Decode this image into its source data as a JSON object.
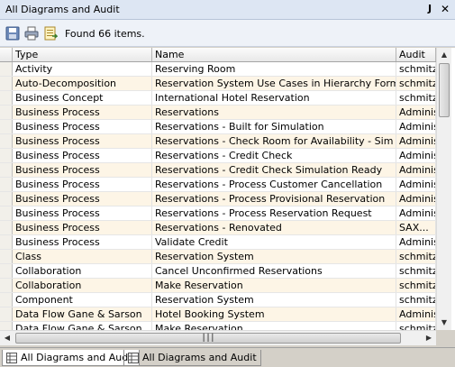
{
  "window": {
    "title": "All Diagrams and Audit"
  },
  "toolbar": {
    "status_text": "Found 66 items."
  },
  "table": {
    "columns": [
      "Type",
      "Name",
      "Audit"
    ],
    "rows": [
      [
        "Activity",
        "Reserving Room",
        "schmitz"
      ],
      [
        "Auto-Decomposition",
        "Reservation System Use Cases in Hierarchy Form",
        "schmitz"
      ],
      [
        "Business Concept",
        "International Hotel Reservation",
        "schmitz"
      ],
      [
        "Business Process",
        "Reservations",
        "Adminis"
      ],
      [
        "Business Process",
        "Reservations - Built for Simulation",
        "Adminis"
      ],
      [
        "Business Process",
        "Reservations - Check Room for Availability - Sim Ready",
        "Adminis"
      ],
      [
        "Business Process",
        "Reservations - Credit Check",
        "Adminis"
      ],
      [
        "Business Process",
        "Reservations - Credit Check Simulation Ready",
        "Adminis"
      ],
      [
        "Business Process",
        "Reservations - Process Customer Cancellation",
        "Adminis"
      ],
      [
        "Business Process",
        "Reservations - Process Provisional Reservation",
        "Adminis"
      ],
      [
        "Business Process",
        "Reservations - Process Reservation Request",
        "Adminis"
      ],
      [
        "Business Process",
        "Reservations - Renovated",
        "SAX..."
      ],
      [
        "Business Process",
        "Validate Credit",
        "Adminis"
      ],
      [
        "Class",
        "Reservation System",
        "schmitz"
      ],
      [
        "Collaboration",
        "Cancel Unconfirmed Reservations",
        "schmitz"
      ],
      [
        "Collaboration",
        "Make Reservation",
        "schmitz"
      ],
      [
        "Component",
        "Reservation System",
        "schmitz"
      ],
      [
        "Data Flow Gane & Sarson",
        "Hotel Booking System",
        "Adminis"
      ],
      [
        "Data Flow Gane & Sarson",
        "Make Reservation",
        "schmitz"
      ]
    ]
  },
  "tabs": [
    {
      "label": "All Diagrams and Audit",
      "active": true
    },
    {
      "label": "All Diagrams and Audit",
      "active": false
    }
  ],
  "icons": {
    "pin": "pin-icon",
    "close": "close-icon",
    "save": "save-icon",
    "print": "print-icon",
    "export": "export-icon"
  }
}
